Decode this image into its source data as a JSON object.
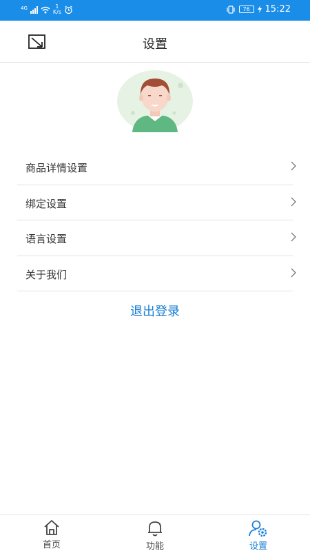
{
  "status_bar": {
    "carrier_tag": "4G",
    "net_speed_value": "1",
    "net_speed_unit": "K/s",
    "battery_level": "76",
    "time": "15:22"
  },
  "header": {
    "title": "设置"
  },
  "menu": {
    "items": [
      {
        "label": "商品详情设置"
      },
      {
        "label": "绑定设置"
      },
      {
        "label": "语言设置"
      },
      {
        "label": "关于我们"
      }
    ]
  },
  "logout_label": "退出登录",
  "tab_bar": {
    "tabs": [
      {
        "label": "首页",
        "icon": "home-icon"
      },
      {
        "label": "功能",
        "icon": "bell-icon"
      },
      {
        "label": "设置",
        "icon": "user-settings-icon",
        "active": true
      }
    ]
  },
  "colors": {
    "accent": "#1a8de9",
    "link": "#1a7fd4",
    "divider": "#e2e2e2"
  }
}
